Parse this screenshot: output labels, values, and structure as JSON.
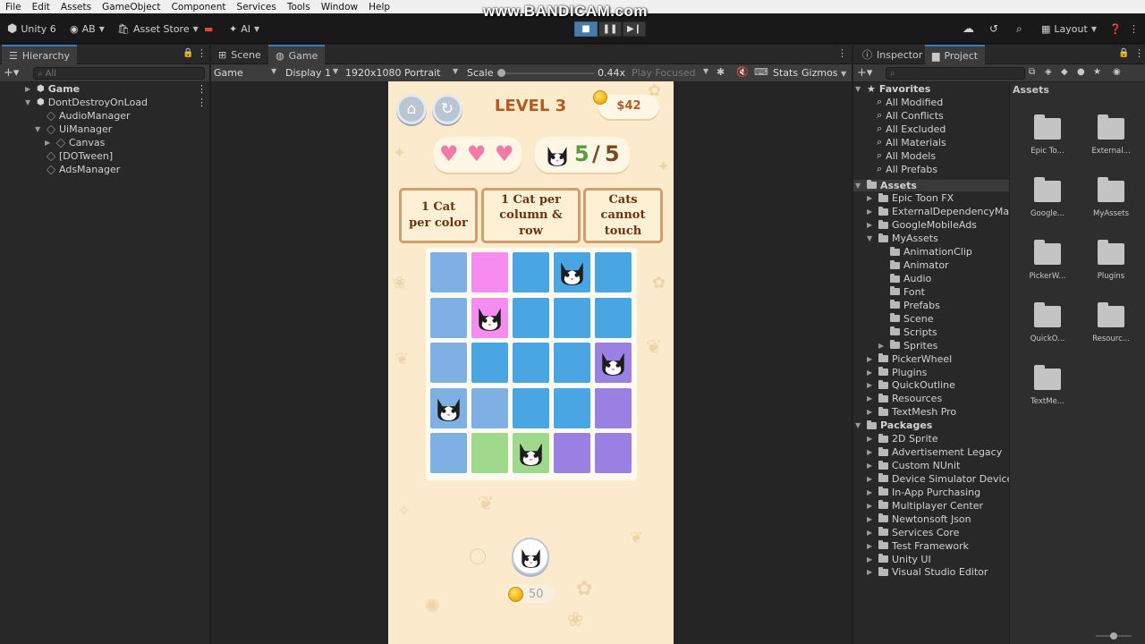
{
  "menu": [
    "File",
    "Edit",
    "Assets",
    "GameObject",
    "Component",
    "Services",
    "Tools",
    "Window",
    "Help"
  ],
  "watermark": "www.BANDICAM.com",
  "toolbar": {
    "unity_version": "Unity 6",
    "account": "AB",
    "asset_store": "Asset Store",
    "ai": "AI",
    "layout": "Layout"
  },
  "hierarchy": {
    "tab": "Hierarchy",
    "search_placeholder": "All",
    "items": [
      {
        "label": "Game"
      },
      {
        "label": "DontDestroyOnLoad"
      },
      {
        "label": "AudioManager"
      },
      {
        "label": "UiManager"
      },
      {
        "label": "Canvas"
      },
      {
        "label": "[DOTween]"
      },
      {
        "label": "AdsManager"
      }
    ]
  },
  "center": {
    "tabs": [
      "Scene",
      "Game"
    ],
    "game_bar": {
      "mode": "Game",
      "display": "Display 1",
      "resolution": "1920x1080 Portrait",
      "scale_label": "Scale",
      "scale_value": "0.44x",
      "play_focused": "Play Focused",
      "stats": "Stats",
      "gizmos": "Gizmos"
    }
  },
  "game": {
    "level": "LEVEL 3",
    "money": "$42",
    "hearts": 3,
    "cats_count": "5",
    "cats_slash": "/",
    "cats_total": "5",
    "rules": [
      "1 Cat\nper color",
      "1 Cat per\ncolumn & row",
      "Cats cannot\ntouch"
    ],
    "grid_colors": [
      [
        "#7fb0e4",
        "#f78cf0",
        "#49a6e2",
        "#49a6e2",
        "#49a6e2"
      ],
      [
        "#7fb0e4",
        "#f78cf0",
        "#49a6e2",
        "#49a6e2",
        "#49a6e2"
      ],
      [
        "#7fb0e4",
        "#49a6e2",
        "#49a6e2",
        "#49a6e2",
        "#9b80e4"
      ],
      [
        "#7fb0e4",
        "#7fb0e4",
        "#49a6e2",
        "#49a6e2",
        "#9b80e4"
      ],
      [
        "#7fb0e4",
        "#9fd98c",
        "#9fd98c",
        "#9b80e4",
        "#9b80e4"
      ]
    ],
    "cats": [
      [
        0,
        3
      ],
      [
        1,
        1
      ],
      [
        2,
        4
      ],
      [
        3,
        0
      ],
      [
        4,
        2
      ]
    ],
    "reward": "50",
    "colors": {
      "accent": "#b65a24",
      "heart": "#f27aa6",
      "count_green": "#5a9b3c",
      "count_brown": "#7a4a22"
    }
  },
  "inspector": {
    "tabs": [
      "Inspector",
      "Project"
    ],
    "favorites_title": "Favorites",
    "favorites": [
      "All Modified",
      "All Conflicts",
      "All Excluded",
      "All Materials",
      "All Models",
      "All Prefabs"
    ],
    "assets_title": "Assets",
    "assets": [
      {
        "label": "Epic Toon FX",
        "depth": 1,
        "open": false
      },
      {
        "label": "ExternalDependencyManage",
        "depth": 1,
        "open": false
      },
      {
        "label": "GoogleMobileAds",
        "depth": 1,
        "open": false
      },
      {
        "label": "MyAssets",
        "depth": 1,
        "open": true
      },
      {
        "label": "AnimationClip",
        "depth": 2,
        "open": null
      },
      {
        "label": "Animator",
        "depth": 2,
        "open": null
      },
      {
        "label": "Audio",
        "depth": 2,
        "open": null
      },
      {
        "label": "Font",
        "depth": 2,
        "open": null
      },
      {
        "label": "Prefabs",
        "depth": 2,
        "open": null
      },
      {
        "label": "Scene",
        "depth": 2,
        "open": null
      },
      {
        "label": "Scripts",
        "depth": 2,
        "open": null
      },
      {
        "label": "Sprites",
        "depth": 2,
        "open": false
      },
      {
        "label": "PickerWheel",
        "depth": 1,
        "open": false
      },
      {
        "label": "Plugins",
        "depth": 1,
        "open": false
      },
      {
        "label": "QuickOutline",
        "depth": 1,
        "open": false
      },
      {
        "label": "Resources",
        "depth": 1,
        "open": false
      },
      {
        "label": "TextMesh Pro",
        "depth": 1,
        "open": false
      }
    ],
    "packages_title": "Packages",
    "packages": [
      "2D Sprite",
      "Advertisement Legacy",
      "Custom NUnit",
      "Device Simulator Devices",
      "In-App Purchasing",
      "Multiplayer Center",
      "Newtonsoft Json",
      "Services Core",
      "Test Framework",
      "Unity UI",
      "Visual Studio Editor"
    ],
    "grid_title": "Assets",
    "grid_folders": [
      "Epic To...",
      "External...",
      "Google...",
      "MyAssets",
      "PickerW...",
      "Plugins",
      "QuickO...",
      "Resourc...",
      "TextMe..."
    ]
  }
}
